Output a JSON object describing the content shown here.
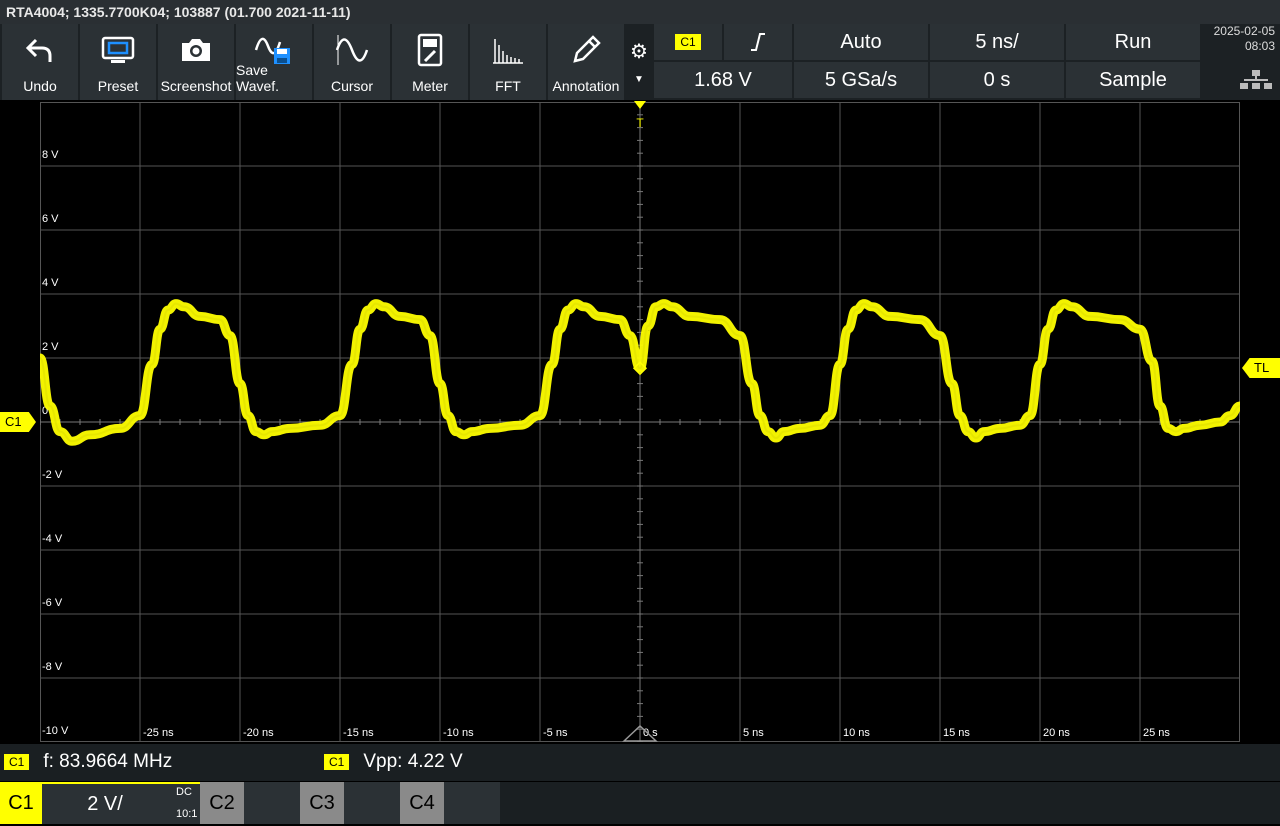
{
  "title": "RTA4004; 1335.7700K04; 103887 (01.700 2021-11-11)",
  "toolbar": {
    "undo": "Undo",
    "preset": "Preset",
    "screenshot": "Screenshot",
    "save_waveform": "Save Wavef.",
    "cursor": "Cursor",
    "meter": "Meter",
    "fft": "FFT",
    "annotation": "Annotation"
  },
  "trigger": {
    "source": "C1",
    "slope": "rising",
    "mode": "Auto",
    "level": "1.68 V",
    "timebase": "5 ns/",
    "sample_rate": "5 GSa/s",
    "offset": "0 s",
    "run_state": "Run",
    "acq_mode": "Sample"
  },
  "datetime": {
    "date": "2025-02-05",
    "time": "08:03"
  },
  "markers": {
    "channel": "C1",
    "trigger_level": "TL",
    "trigger_pos": "T"
  },
  "colors": {
    "channel1": "#ffff00",
    "grid": "#555555",
    "toolbar_bg": "#2b3135"
  },
  "chart_data": {
    "type": "line",
    "title": "",
    "xlabel": "",
    "ylabel": "",
    "xlim": [
      -30,
      30
    ],
    "ylim": [
      -10,
      10
    ],
    "x_unit": "ns",
    "y_unit": "V",
    "y_ticks": [
      "8 V",
      "6 V",
      "4 V",
      "2 V",
      "0",
      "-2 V",
      "-4 V",
      "-6 V",
      "-8 V",
      "-10 V"
    ],
    "y_tick_values": [
      8,
      6,
      4,
      2,
      0,
      -2,
      -4,
      -6,
      -8,
      -10
    ],
    "x_ticks": [
      "-25 ns",
      "-20 ns",
      "-15 ns",
      "-10 ns",
      "-5 ns",
      "0 s",
      "5 ns",
      "10 ns",
      "15 ns",
      "20 ns",
      "25 ns"
    ],
    "x_tick_values": [
      -25,
      -20,
      -15,
      -10,
      -5,
      0,
      5,
      10,
      15,
      20,
      25
    ],
    "grid": true,
    "series": [
      {
        "color": "#ffff00",
        "x": [
          -30,
          -29.5,
          -29,
          -28.4,
          -27.5,
          -26,
          -25,
          -24.4,
          -24,
          -23.6,
          -23.2,
          -22.8,
          -22,
          -21,
          -20.5,
          -20,
          -19.6,
          -19.2,
          -18.8,
          -18.4,
          -17.5,
          -16,
          -15,
          -14.4,
          -14,
          -13.6,
          -13.2,
          -12.8,
          -12,
          -11,
          -10.5,
          -10,
          -9.6,
          -9.2,
          -8.8,
          -8.4,
          -7.5,
          -6,
          -5,
          -4.4,
          -4,
          -3.6,
          -3.2,
          -2.8,
          -2,
          -1,
          -0.5,
          0,
          0.4,
          0.8,
          1.2,
          1.6,
          2.5,
          4,
          5,
          5.6,
          6,
          6.4,
          6.8,
          7.2,
          8,
          9,
          9.5,
          10,
          10.4,
          10.8,
          11.2,
          11.6,
          12.5,
          14,
          15,
          15.6,
          16,
          16.4,
          16.8,
          17.2,
          18,
          19,
          19.5,
          20,
          20.4,
          20.8,
          21.2,
          21.6,
          22.5,
          24,
          25,
          25.6,
          26,
          26.4,
          26.8,
          27.2,
          28,
          29,
          29.5,
          30
        ],
        "y": [
          2.0,
          0.5,
          -0.3,
          -0.6,
          -0.4,
          -0.2,
          0.2,
          1.8,
          2.9,
          3.5,
          3.7,
          3.6,
          3.3,
          3.2,
          2.7,
          1.2,
          0.2,
          -0.3,
          -0.4,
          -0.3,
          -0.2,
          -0.1,
          0.2,
          1.8,
          2.9,
          3.5,
          3.7,
          3.6,
          3.3,
          3.2,
          2.7,
          1.2,
          0.2,
          -0.3,
          -0.4,
          -0.3,
          -0.2,
          -0.1,
          0.2,
          1.8,
          2.9,
          3.5,
          3.7,
          3.6,
          3.3,
          3.2,
          2.7,
          1.68,
          3.0,
          3.6,
          3.7,
          3.6,
          3.3,
          3.2,
          2.7,
          1.2,
          0.2,
          -0.3,
          -0.5,
          -0.3,
          -0.2,
          -0.1,
          0.2,
          1.8,
          2.9,
          3.5,
          3.7,
          3.6,
          3.3,
          3.2,
          2.7,
          1.2,
          0.2,
          -0.3,
          -0.5,
          -0.3,
          -0.2,
          -0.1,
          0.2,
          1.8,
          2.9,
          3.5,
          3.7,
          3.6,
          3.3,
          3.2,
          2.9,
          1.9,
          0.5,
          -0.2,
          -0.3,
          -0.2,
          -0.1,
          0.0,
          0.2,
          0.5
        ]
      }
    ]
  },
  "measurements": [
    {
      "source": "C1",
      "text": "f: 83.9664 MHz"
    },
    {
      "source": "C1",
      "text": "Vpp: 4.22 V"
    }
  ],
  "channels": {
    "c1": {
      "label": "C1",
      "scale": "2 V/",
      "coupling": "DC",
      "probe": "10:1"
    },
    "c2": {
      "label": "C2"
    },
    "c3": {
      "label": "C3"
    },
    "c4": {
      "label": "C4"
    }
  }
}
